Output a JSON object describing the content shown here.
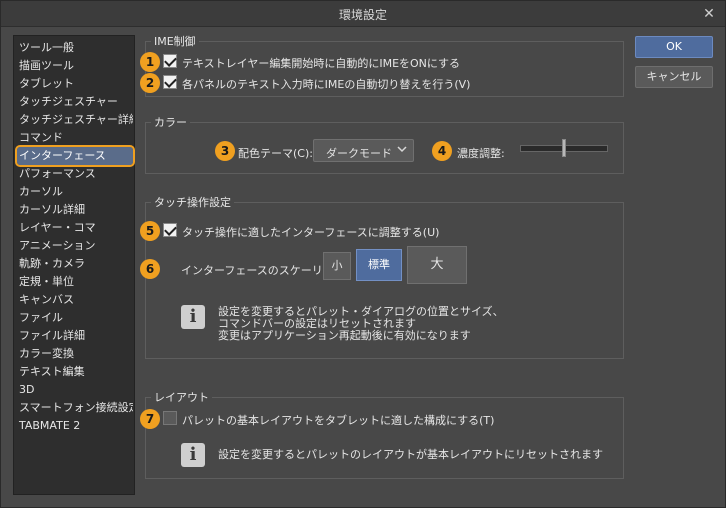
{
  "window": {
    "title": "環境設定",
    "close_glyph": "✕"
  },
  "sidebar": {
    "items": [
      {
        "label": "ツール一般"
      },
      {
        "label": "描画ツール"
      },
      {
        "label": "タブレット"
      },
      {
        "label": "タッチジェスチャー"
      },
      {
        "label": "タッチジェスチャー詳細"
      },
      {
        "label": "コマンド"
      },
      {
        "label": "インターフェース",
        "selected": true
      },
      {
        "label": "パフォーマンス"
      },
      {
        "label": "カーソル"
      },
      {
        "label": "カーソル詳細"
      },
      {
        "label": "レイヤー・コマ"
      },
      {
        "label": "アニメーション"
      },
      {
        "label": "軌跡・カメラ"
      },
      {
        "label": "定規・単位"
      },
      {
        "label": "キャンバス"
      },
      {
        "label": "ファイル"
      },
      {
        "label": "ファイル詳細"
      },
      {
        "label": "カラー変換"
      },
      {
        "label": "テキスト編集"
      },
      {
        "label": "3D"
      },
      {
        "label": "スマートフォン接続設定"
      },
      {
        "label": "TABMATE 2"
      }
    ]
  },
  "buttons": {
    "ok": "OK",
    "cancel": "キャンセル"
  },
  "ime": {
    "title": "IME制御",
    "option1": {
      "badge": "1",
      "label": "テキストレイヤー編集開始時に自動的にIMEをONにする",
      "checked": true
    },
    "option2": {
      "badge": "2",
      "label": "各パネルのテキスト入力時にIMEの自動切り替えを行う(V)",
      "checked": true
    }
  },
  "color": {
    "title": "カラー",
    "theme": {
      "badge": "3",
      "label": "配色テーマ(C):",
      "value": "ダークモード"
    },
    "density": {
      "badge": "4",
      "label": "濃度調整:",
      "level_fraction": 0.5
    }
  },
  "touch": {
    "title": "タッチ操作設定",
    "option": {
      "badge": "5",
      "label": "タッチ操作に適したインターフェースに調整する(U)",
      "checked": true
    },
    "scaling": {
      "badge": "6",
      "label": "インターフェースのスケーリング:",
      "small": "小",
      "standard": "標準",
      "large": "大",
      "selected": "standard"
    },
    "info_line1": "設定を変更するとパレット・ダイアログの位置とサイズ、",
    "info_line2": "コマンドバーの設定はリセットされます",
    "info_line3": "変更はアプリケーション再起動後に有効になります"
  },
  "layout": {
    "title": "レイアウト",
    "option": {
      "badge": "7",
      "label": "パレットの基本レイアウトをタブレットに適した構成にする(T)",
      "checked": false
    },
    "info": "設定を変更するとパレットのレイアウトが基本レイアウトにリセットされます"
  },
  "colors": {
    "accent": "#f0a020",
    "primary_button": "#4f6c9e",
    "selection": "#5a6c8a"
  }
}
